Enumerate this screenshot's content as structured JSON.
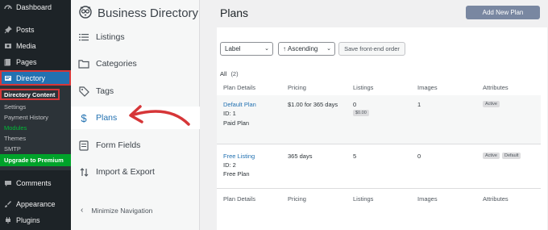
{
  "wp_menu": {
    "dashboard": "Dashboard",
    "posts": "Posts",
    "media": "Media",
    "pages": "Pages",
    "directory": "Directory",
    "submenu": [
      "Directory Content",
      "Settings",
      "Payment History",
      "Modules",
      "Themes",
      "SMTP",
      "Upgrade to Premium"
    ],
    "comments": "Comments",
    "appearance": "Appearance",
    "plugins": "Plugins"
  },
  "dir_nav": {
    "brand": "Business Directory",
    "items": [
      "Listings",
      "Categories",
      "Tags",
      "Plans",
      "Form Fields",
      "Import & Export"
    ],
    "minimize": "Minimize Navigation"
  },
  "page": {
    "title": "Plans",
    "add_button": "Add New Plan"
  },
  "filters": {
    "sort_field": "Label",
    "sort_order": "Ascending",
    "save_button": "Save front-end order"
  },
  "summary": {
    "all_label": "All",
    "all_count": "(2)"
  },
  "table": {
    "columns": [
      "Plan Details",
      "Pricing",
      "Listings",
      "Images",
      "Attributes"
    ],
    "rows": [
      {
        "name": "Default Plan",
        "id": "ID: 1",
        "type": "Paid Plan",
        "pricing": "$1.00 for 365 days",
        "listings": "0",
        "listings_badge": "$0.00",
        "images": "1",
        "attributes": [
          "Active"
        ]
      },
      {
        "name": "Free Listing",
        "id": "ID: 2",
        "type": "Free Plan",
        "pricing": "365 days",
        "listings": "5",
        "images": "0",
        "attributes": [
          "Active",
          "Default"
        ]
      }
    ]
  },
  "colors": {
    "wp_sidebar": "#1d2327",
    "wp_active": "#2271b1",
    "highlight_red": "#d63638",
    "button": "#7987a1"
  }
}
